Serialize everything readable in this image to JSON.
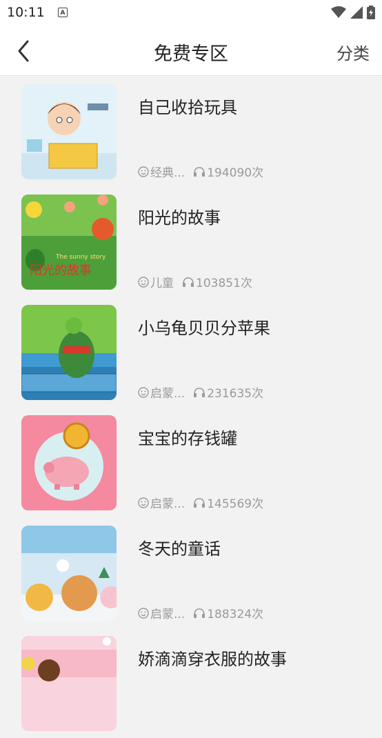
{
  "status": {
    "time": "10:11",
    "a_icon": "A"
  },
  "header": {
    "title": "免费专区",
    "category": "分类"
  },
  "items": [
    {
      "title": "自己收拾玩具",
      "tag": "经典...",
      "plays": "194090次",
      "icon": "story-thumbnail",
      "bg": "#dbeef6"
    },
    {
      "title": "阳光的故事",
      "tag": "儿童",
      "plays": "103851次",
      "icon": "story-thumbnail",
      "bg": "#4fa93a"
    },
    {
      "title": "小乌龟贝贝分苹果",
      "tag": "启蒙...",
      "plays": "231635次",
      "icon": "story-thumbnail",
      "bg": "#6bbf3a"
    },
    {
      "title": "宝宝的存钱罐",
      "tag": "启蒙...",
      "plays": "145569次",
      "icon": "story-thumbnail",
      "bg": "#f28aa6"
    },
    {
      "title": "冬天的童话",
      "tag": "启蒙...",
      "plays": "188324次",
      "icon": "story-thumbnail",
      "bg": "#cfe3f0"
    },
    {
      "title": "娇滴滴穿衣服的故事",
      "tag": "",
      "plays": "",
      "icon": "story-thumbnail",
      "bg": "#f7c7d4"
    }
  ]
}
